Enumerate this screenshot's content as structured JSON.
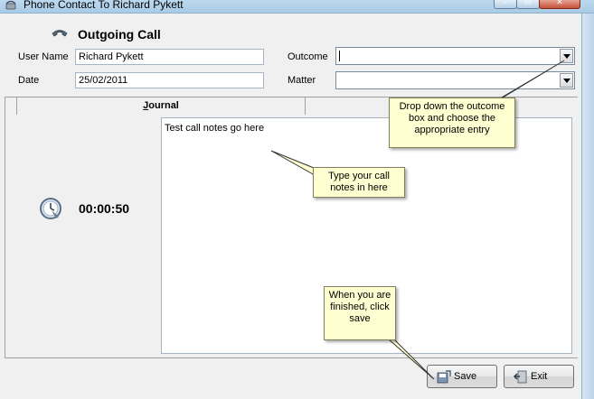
{
  "window": {
    "title": "Phone Contact To Richard Pykett",
    "min_symbol": "–",
    "max_symbol": "▭",
    "close_symbol": "✕"
  },
  "form": {
    "heading": "Outgoing Call",
    "user_name_label": "User Name",
    "user_name_value": "Richard Pykett",
    "date_label": "Date",
    "date_value": "25/02/2011",
    "outcome_label": "Outcome",
    "outcome_value": "",
    "matter_label": "Matter",
    "matter_value": ""
  },
  "tabs": [
    {
      "label_first": "J",
      "label_rest": "ournal"
    }
  ],
  "journal_text": "Test call notes go here",
  "timer": "00:00:50",
  "buttons": {
    "save": "Save",
    "exit": "Exit"
  },
  "callouts": {
    "outcome_tip": "Drop down the outcome box and choose the appropriate entry",
    "notes_tip": "Type your call notes in here",
    "save_tip": "When you are finished, click save"
  },
  "colors": {
    "callout_bg": "#ffffd2",
    "titlebar": "#bcd9ef"
  }
}
